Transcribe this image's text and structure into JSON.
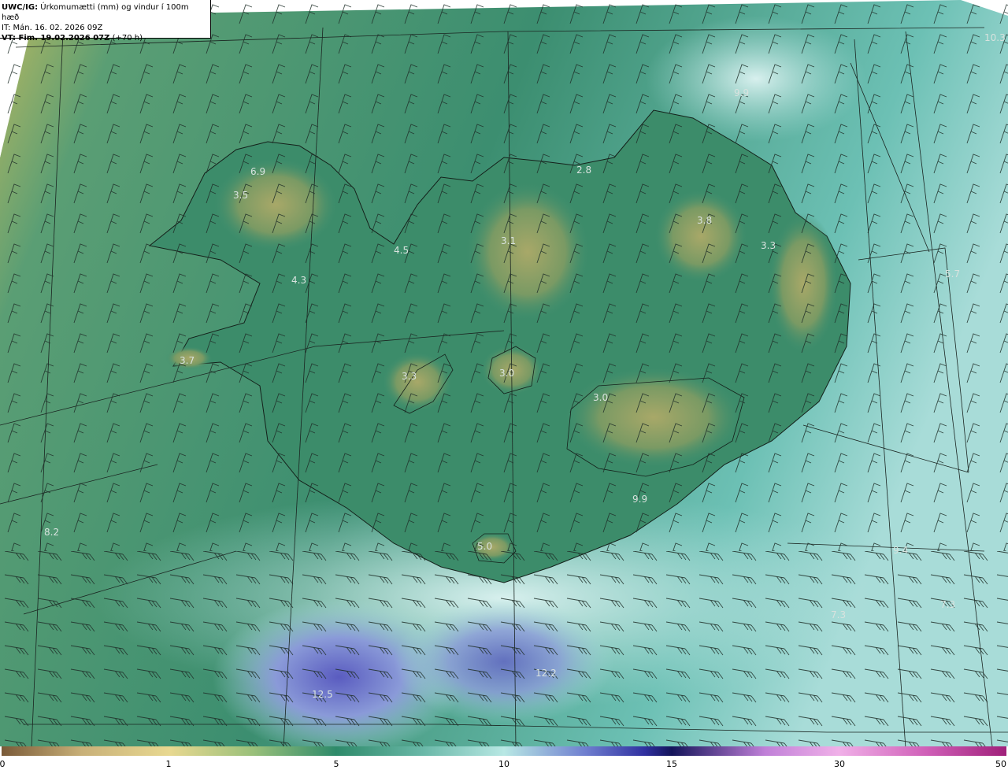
{
  "header": {
    "product": "UWC/IG:",
    "description": "Úrkomumætti (mm) og vindur í 100m hæð",
    "initial_time": "IT: Mán. 16. 02. 2026 09Z",
    "valid_label": "VT: Fim. 19.02.2026 07Z",
    "lead": "(+70 h)"
  },
  "map_values": [
    {
      "id": "v1",
      "text": "10.3"
    },
    {
      "id": "v2",
      "text": "9.9"
    },
    {
      "id": "v3",
      "text": "6.9"
    },
    {
      "id": "v4",
      "text": "3.5"
    },
    {
      "id": "v5",
      "text": "2.8"
    },
    {
      "id": "v6",
      "text": "3.8"
    },
    {
      "id": "v7",
      "text": "3.3"
    },
    {
      "id": "v8",
      "text": "3.1"
    },
    {
      "id": "v9",
      "text": "5.7"
    },
    {
      "id": "v10",
      "text": "4.5"
    },
    {
      "id": "v11",
      "text": "4.3"
    },
    {
      "id": "v12",
      "text": "3.7"
    },
    {
      "id": "v13",
      "text": "3.3"
    },
    {
      "id": "v14",
      "text": "3.0"
    },
    {
      "id": "v15",
      "text": "3.0"
    },
    {
      "id": "v16",
      "text": "9.9"
    },
    {
      "id": "v17",
      "text": "8.2"
    },
    {
      "id": "v18",
      "text": "5.0"
    },
    {
      "id": "v19",
      "text": "9.4"
    },
    {
      "id": "v20",
      "text": "7.3"
    },
    {
      "id": "v21",
      "text": "7.3"
    },
    {
      "id": "v22",
      "text": "12.2"
    },
    {
      "id": "v23",
      "text": "12.5"
    }
  ],
  "colorbar": {
    "ticks": [
      "0",
      "1",
      "5",
      "10",
      "15",
      "30",
      "50"
    ],
    "colors": [
      "#7a5a38",
      "#e8d890",
      "#2e8a6a",
      "#b8e8e4",
      "#14145a",
      "#f0b0e8",
      "#a0207a"
    ]
  },
  "palette": {
    "land_high": "#8fa060",
    "land": "#3e9a74",
    "sea": "#8fd4cc",
    "heavy": "#6a70c8",
    "dry": "#c8c070"
  }
}
